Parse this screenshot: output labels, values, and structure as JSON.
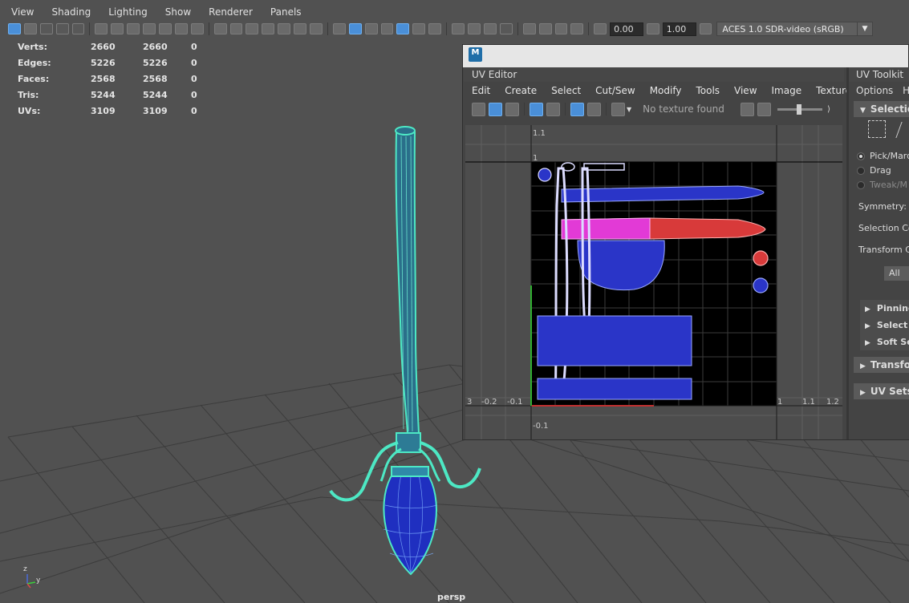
{
  "viewport": {
    "menus": [
      "View",
      "Shading",
      "Lighting",
      "Show",
      "Renderer",
      "Panels"
    ],
    "exposure_value": "0.00",
    "gamma_value": "1.00",
    "color_management": "ACES 1.0 SDR-video (sRGB)",
    "camera_label": "persp",
    "axis_z": "z",
    "axis_y": "y",
    "stats": [
      {
        "label": "Verts:",
        "a": "2660",
        "b": "2660",
        "c": "0"
      },
      {
        "label": "Edges:",
        "a": "5226",
        "b": "5226",
        "c": "0"
      },
      {
        "label": "Faces:",
        "a": "2568",
        "b": "2568",
        "c": "0"
      },
      {
        "label": "Tris:",
        "a": "5244",
        "b": "5244",
        "c": "0"
      },
      {
        "label": "UVs:",
        "a": "3109",
        "b": "3109",
        "c": "0"
      }
    ]
  },
  "uv_window": {
    "logo": "M",
    "panel_title": "UV Editor",
    "menus": [
      "Edit",
      "Create",
      "Select",
      "Cut/Sew",
      "Modify",
      "Tools",
      "View",
      "Image",
      "Textures"
    ],
    "no_texture": "No texture found",
    "ticks": {
      "top_1_1": "1.1",
      "top_1": "1",
      "m02": "-0.2",
      "m01": "-0.1",
      "m0_3": "3",
      "r1": "1",
      "r11": "1.1",
      "r12": "1.2",
      "b_m01": "-0.1"
    }
  },
  "toolkit": {
    "title": "UV Toolkit",
    "options": "Options",
    "options_cut": "He",
    "section_selection": "Selection",
    "radio": [
      "Pick/Marq",
      "Drag",
      "Tweak/M"
    ],
    "symmetry": "Symmetry:",
    "selection_constraint": "Selection Co",
    "transform_constraint": "Transform Co",
    "all_button": "All",
    "subs": [
      "Pinning",
      "Select B",
      "Soft Sel"
    ],
    "section_transform": "Transfor",
    "section_uvsets": "UV Sets"
  },
  "colors": {
    "viewport_bg": "#515151",
    "wire_cyan": "#4de8c4",
    "uv_blue": "#3e48d8",
    "uv_magenta": "#e23ad6",
    "uv_red": "#d83a3a",
    "highlight": "#4a8fd8"
  }
}
